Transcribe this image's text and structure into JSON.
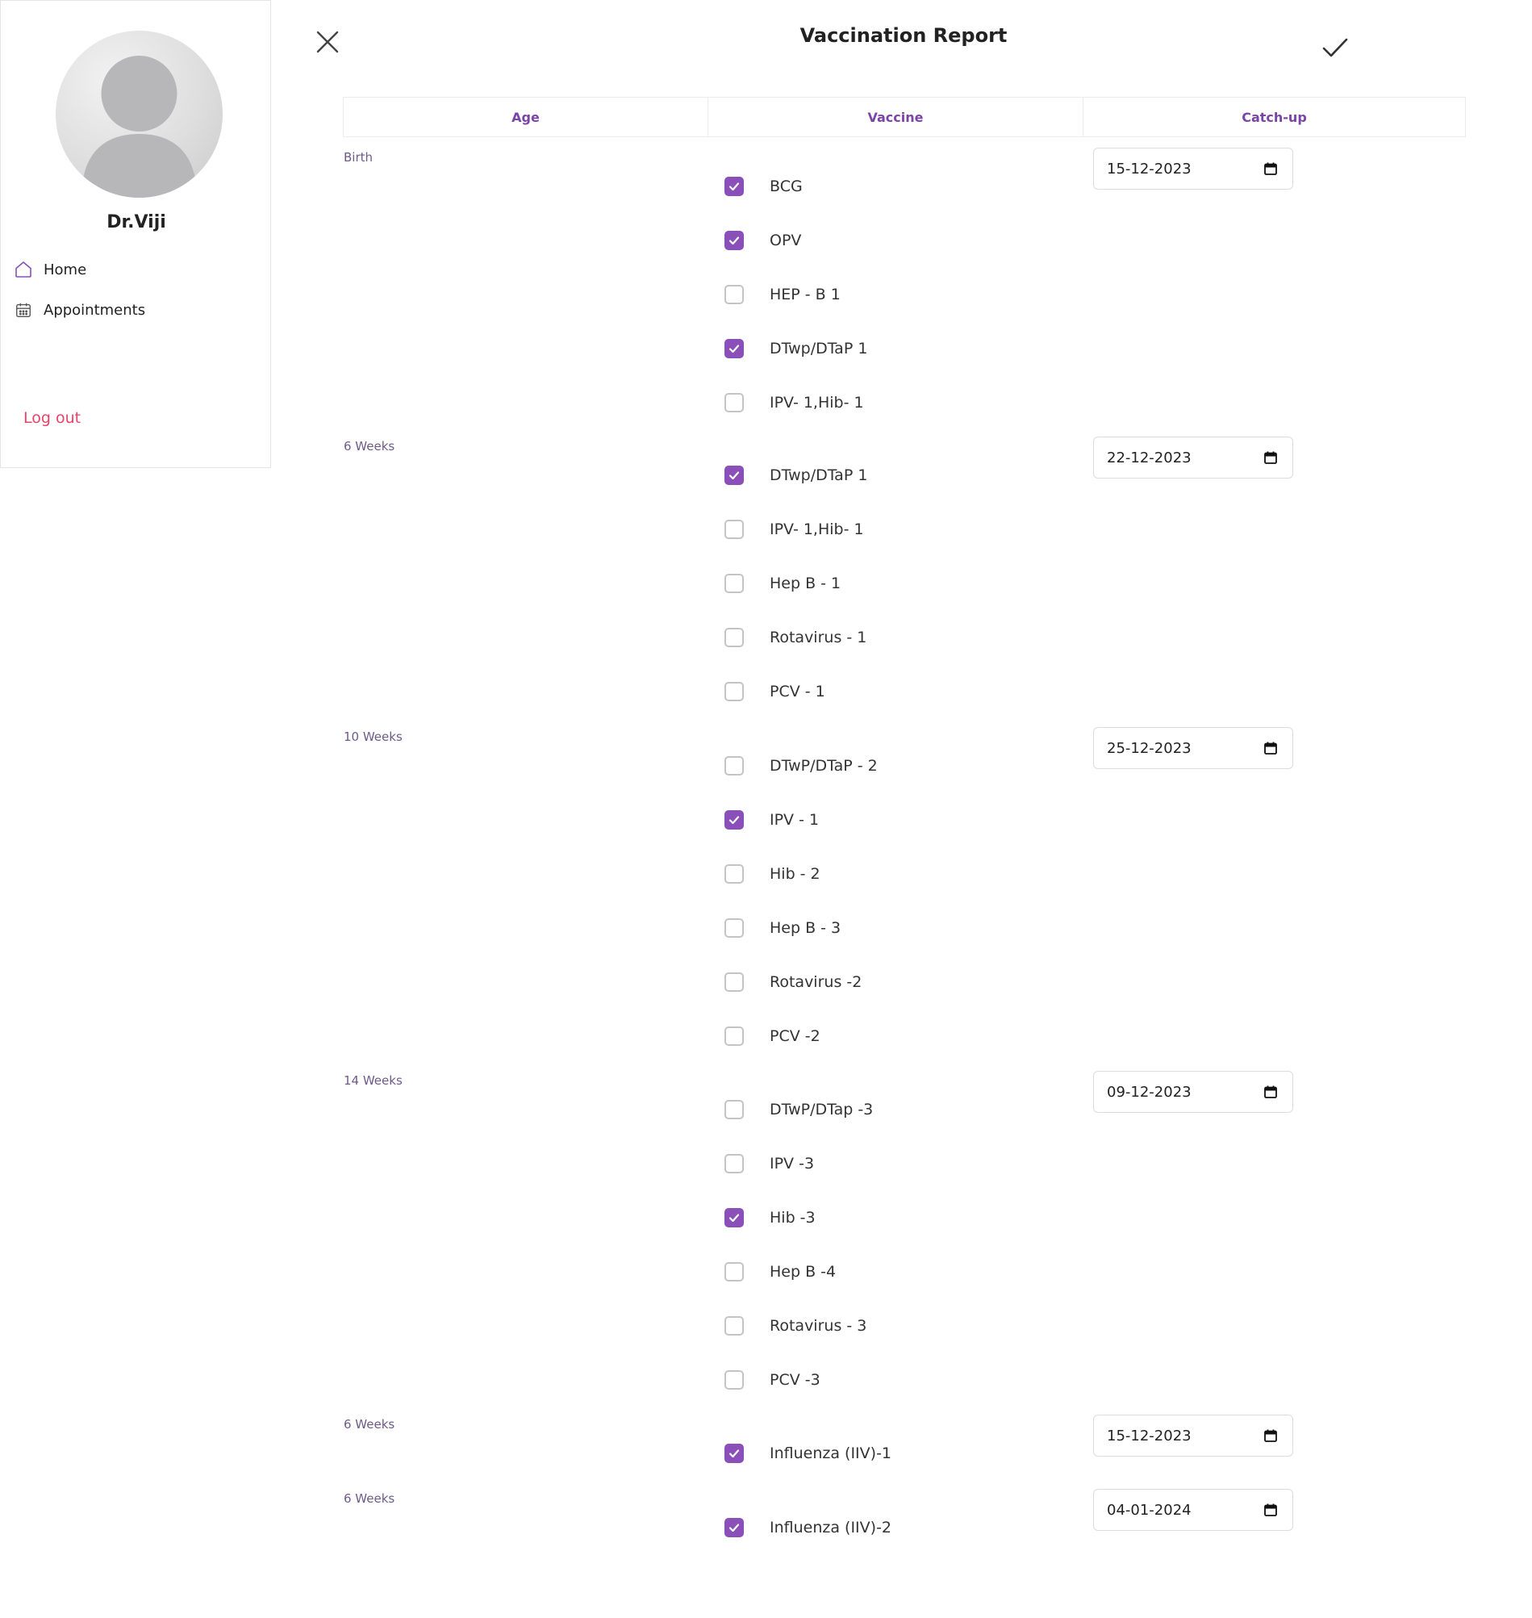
{
  "sidebar": {
    "doctor_name": "Dr.Viji",
    "nav": [
      {
        "label": "Home",
        "icon": "home-icon"
      },
      {
        "label": "Appointments",
        "icon": "calendar-icon"
      }
    ],
    "logout_label": "Log out"
  },
  "header": {
    "title": "Vaccination Report"
  },
  "table": {
    "columns": [
      "Age",
      "Vaccine",
      "Catch-up"
    ],
    "groups": [
      {
        "age": "Birth",
        "catchup": "15-12-2023",
        "vaccines": [
          {
            "name": "BCG",
            "checked": true
          },
          {
            "name": "OPV",
            "checked": true
          },
          {
            "name": "HEP - B 1",
            "checked": false
          },
          {
            "name": "DTwp/DTaP 1",
            "checked": true
          },
          {
            "name": "IPV- 1,Hib- 1",
            "checked": false
          }
        ]
      },
      {
        "age": "6 Weeks",
        "catchup": "22-12-2023",
        "vaccines": [
          {
            "name": "DTwp/DTaP 1",
            "checked": true
          },
          {
            "name": "IPV- 1,Hib- 1",
            "checked": false
          },
          {
            "name": "Hep B - 1",
            "checked": false
          },
          {
            "name": "Rotavirus - 1",
            "checked": false
          },
          {
            "name": "PCV - 1",
            "checked": false
          }
        ]
      },
      {
        "age": "10 Weeks",
        "catchup": "25-12-2023",
        "vaccines": [
          {
            "name": "DTwP/DTaP - 2",
            "checked": false
          },
          {
            "name": "IPV - 1",
            "checked": true
          },
          {
            "name": "Hib - 2",
            "checked": false
          },
          {
            "name": "Hep B - 3",
            "checked": false
          },
          {
            "name": "Rotavirus -2",
            "checked": false
          },
          {
            "name": "PCV -2",
            "checked": false
          }
        ]
      },
      {
        "age": "14 Weeks",
        "catchup": "09-12-2023",
        "vaccines": [
          {
            "name": "DTwP/DTap -3",
            "checked": false
          },
          {
            "name": "IPV -3",
            "checked": false
          },
          {
            "name": "Hib -3",
            "checked": true
          },
          {
            "name": "Hep B -4",
            "checked": false
          },
          {
            "name": "Rotavirus - 3",
            "checked": false
          },
          {
            "name": "PCV -3",
            "checked": false
          }
        ]
      },
      {
        "age": "6 Weeks",
        "catchup": "15-12-2023",
        "vaccines": [
          {
            "name": "Influenza (IIV)-1",
            "checked": true
          }
        ]
      },
      {
        "age": "6 Weeks",
        "catchup": "04-01-2024",
        "vaccines": [
          {
            "name": "Influenza (IIV)-2",
            "checked": true
          }
        ]
      }
    ]
  },
  "colors": {
    "accent": "#8a4fb8",
    "header_text": "#7b44a8",
    "logout": "#e8436a"
  }
}
